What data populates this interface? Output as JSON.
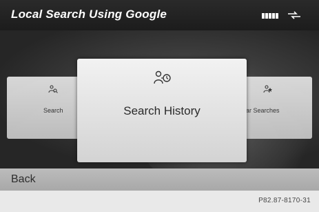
{
  "header": {
    "title": "Local Search Using Google"
  },
  "status": {
    "signal_icon": "signal-strength-icon",
    "connection_icon": "data-transfer-icon"
  },
  "menu": {
    "items": [
      {
        "label": "Search",
        "icon": "search-person-icon"
      },
      {
        "label": "Search History",
        "icon": "search-history-icon",
        "selected": true
      },
      {
        "label": "Popular Searches",
        "icon": "popular-searches-icon"
      }
    ]
  },
  "back": {
    "label": "Back"
  },
  "footer": {
    "reference": "P82.87-8170-31"
  },
  "colors": {
    "title_bar": "#1c1c1c",
    "tile": "#d8d8d8",
    "back_bar": "#b2b2b2"
  }
}
